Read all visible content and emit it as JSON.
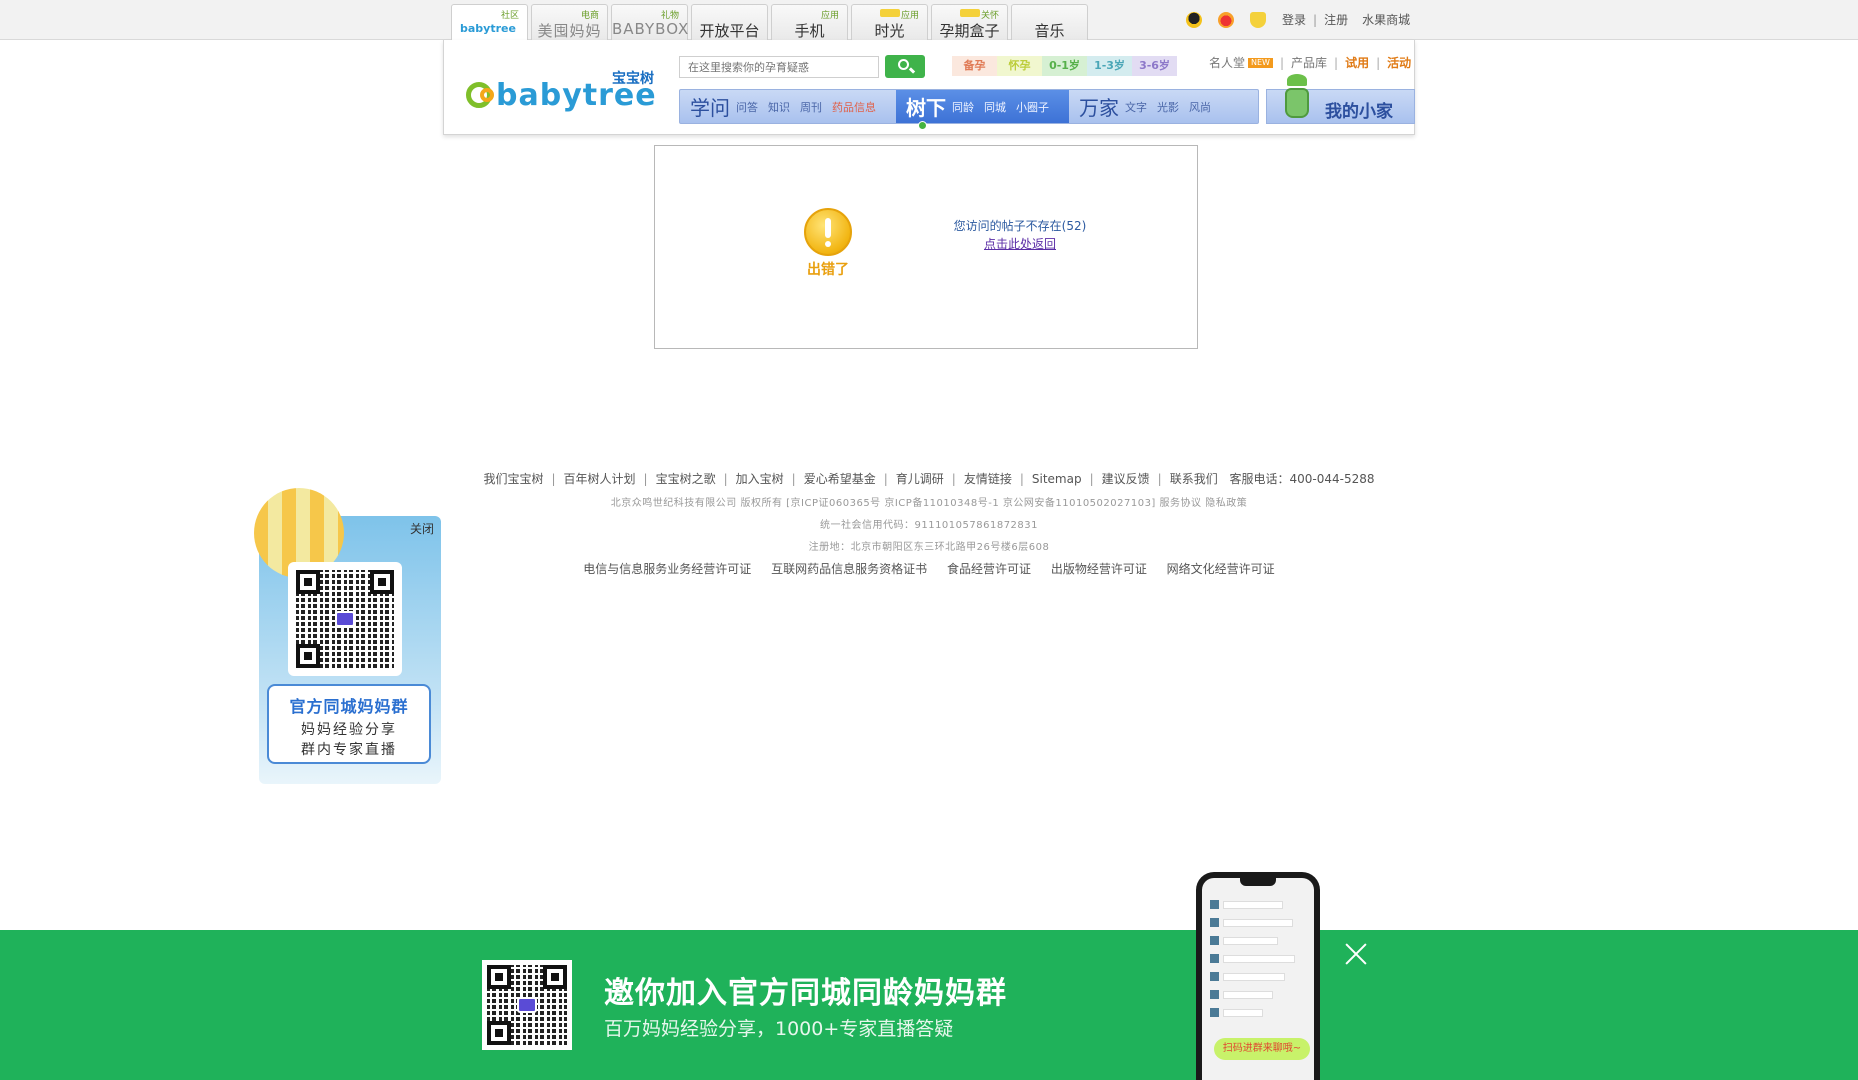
{
  "topbar": {
    "tabs": [
      {
        "tag": "社区",
        "name": "babytree",
        "logo": true
      },
      {
        "tag": "电商",
        "name": "美囤妈妈"
      },
      {
        "tag": "礼物",
        "name": "BABYBOX"
      },
      {
        "tag": "",
        "name": "开放平台"
      },
      {
        "tag": "应用",
        "name": "手机"
      },
      {
        "tag": "应用",
        "name": "时光",
        "hot": true
      },
      {
        "tag": "关怀",
        "name": "孕期盒子",
        "hot": true
      },
      {
        "tag": "",
        "name": "音乐"
      }
    ],
    "icons": [
      "qq-icon",
      "weibo-icon",
      "shield-icon"
    ],
    "login": "登录",
    "register": "注册",
    "shop": "水果商城"
  },
  "header": {
    "logo_cn": "宝宝树",
    "logo_en": "babytree",
    "search_placeholder": "在这里搜索你的孕育疑惑",
    "stages": [
      "备孕",
      "怀孕",
      "0-1岁",
      "1-3岁",
      "3-6岁"
    ],
    "links": {
      "celebrity": "名人堂",
      "new_badge": "NEW",
      "products": "产品库",
      "trial": "试用",
      "events": "活动"
    },
    "nav": [
      {
        "big": "学问",
        "items": [
          "问答",
          "知识",
          "周刊",
          "药品信息"
        ],
        "red_index": 3
      },
      {
        "big": "树下",
        "items": [
          "同龄",
          "同城",
          "小圈子"
        ],
        "active": true
      },
      {
        "big": "万家",
        "items": [
          "文字",
          "光影",
          "风尚"
        ]
      }
    ],
    "my_home": "我的小家"
  },
  "error": {
    "title": "出错了",
    "message": "您访问的帖子不存在(52)",
    "back_link": "点击此处返回"
  },
  "footer": {
    "links": [
      "我们宝宝树",
      "百年树人计划",
      "宝宝树之歌",
      "加入宝树",
      "爱心希望基金",
      "育儿调研",
      "友情链接",
      "Sitemap",
      "建议反馈",
      "联系我们"
    ],
    "hotline": "客服电话：400-044-5288",
    "copyright": "北京众鸣世纪科技有限公司 版权所有 [京ICP证060365号 京ICP备11010348号-1 京公网安备11010502027103] 服务协议 隐私政策",
    "credit_code": "统一社会信用代码：911101057861872831",
    "address": "注册地：北京市朝阳区东三环北路甲26号楼6层608",
    "licenses": [
      "电信与信息服务业务经营许可证",
      "互联网药品信息服务资格证书",
      "食品经营许可证",
      "出版物经营许可证",
      "网络文化经营许可证"
    ]
  },
  "float_qr": {
    "close": "关闭",
    "line1": "官方同城妈妈群",
    "line2": "妈妈经验分享",
    "line3": "群内专家直播"
  },
  "banner": {
    "title": "邀你加入官方同城同龄妈妈群",
    "subtitle": "百万妈妈经验分享，1000+专家直播答疑",
    "phone_cta": "扫码进群来聊哦~"
  }
}
